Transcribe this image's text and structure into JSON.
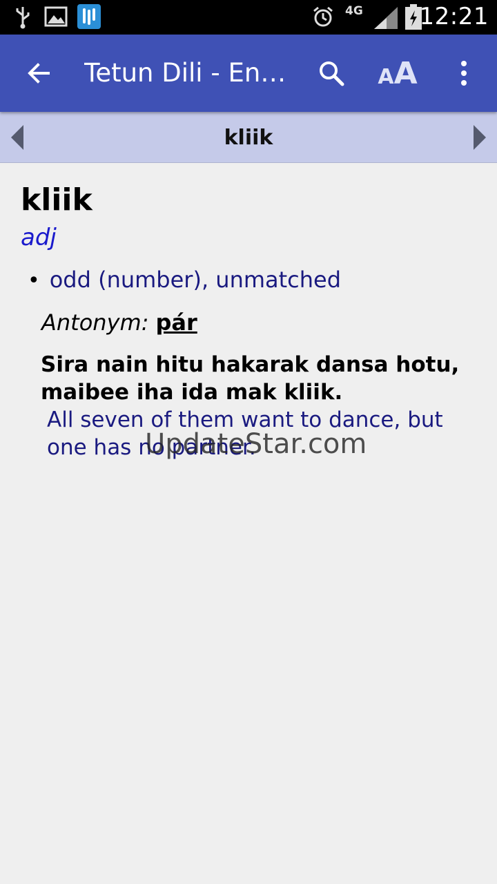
{
  "status_bar": {
    "time": "12:21",
    "network": "4G",
    "icons": [
      "usb-icon",
      "image-icon",
      "app-notification-icon",
      "alarm-icon",
      "signal-icon",
      "battery-icon"
    ]
  },
  "app_bar": {
    "title": "Tetun Dili - Eng…",
    "icons": [
      "back-arrow-icon",
      "search-icon",
      "font-size-icon",
      "overflow-menu-icon"
    ],
    "font_size_small": "A",
    "font_size_big": "A",
    "color": "#3f51b5"
  },
  "nav_bar": {
    "title": "kliik",
    "color": "#c5cae9"
  },
  "entry": {
    "headword": "kliik",
    "part_of_speech": "adj",
    "sense": "odd (number), unmatched",
    "bullet": "•",
    "antonym_label": "Antonym:",
    "antonym_word": "pár",
    "example": "Sira nain hitu hakarak dansa hotu, maibee iha ida mak kliik.",
    "translation": "All seven of them want to dance, but one has no partner."
  },
  "watermark": "UpdateStar.com"
}
